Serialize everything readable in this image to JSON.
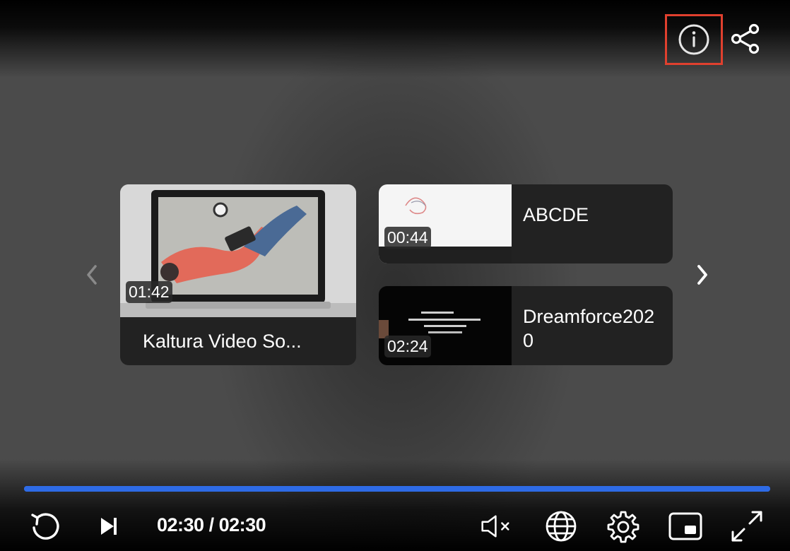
{
  "player": {
    "current_time": "02:30",
    "duration": "02:30",
    "time_separator": " / ",
    "progress_fraction": 1.0,
    "accent_color": "#2e6be6",
    "highlight_color": "#e0402e"
  },
  "top_controls": [
    {
      "icon": "info-icon"
    },
    {
      "icon": "share-icon"
    }
  ],
  "related": {
    "items": [
      {
        "title": "Kaltura Video So...",
        "duration": "01:42"
      },
      {
        "title": "ABCDE",
        "duration": "00:44"
      },
      {
        "title": "Dreamforce2020",
        "duration": "02:24"
      }
    ],
    "nav": {
      "prev_icon": "chevron-left-icon",
      "next_icon": "chevron-right-icon"
    }
  },
  "bottom_controls": {
    "left": [
      "replay-icon",
      "next-icon"
    ],
    "right": [
      "volume-muted-icon",
      "language-icon",
      "settings-icon",
      "picture-in-picture-icon",
      "fullscreen-icon"
    ]
  }
}
